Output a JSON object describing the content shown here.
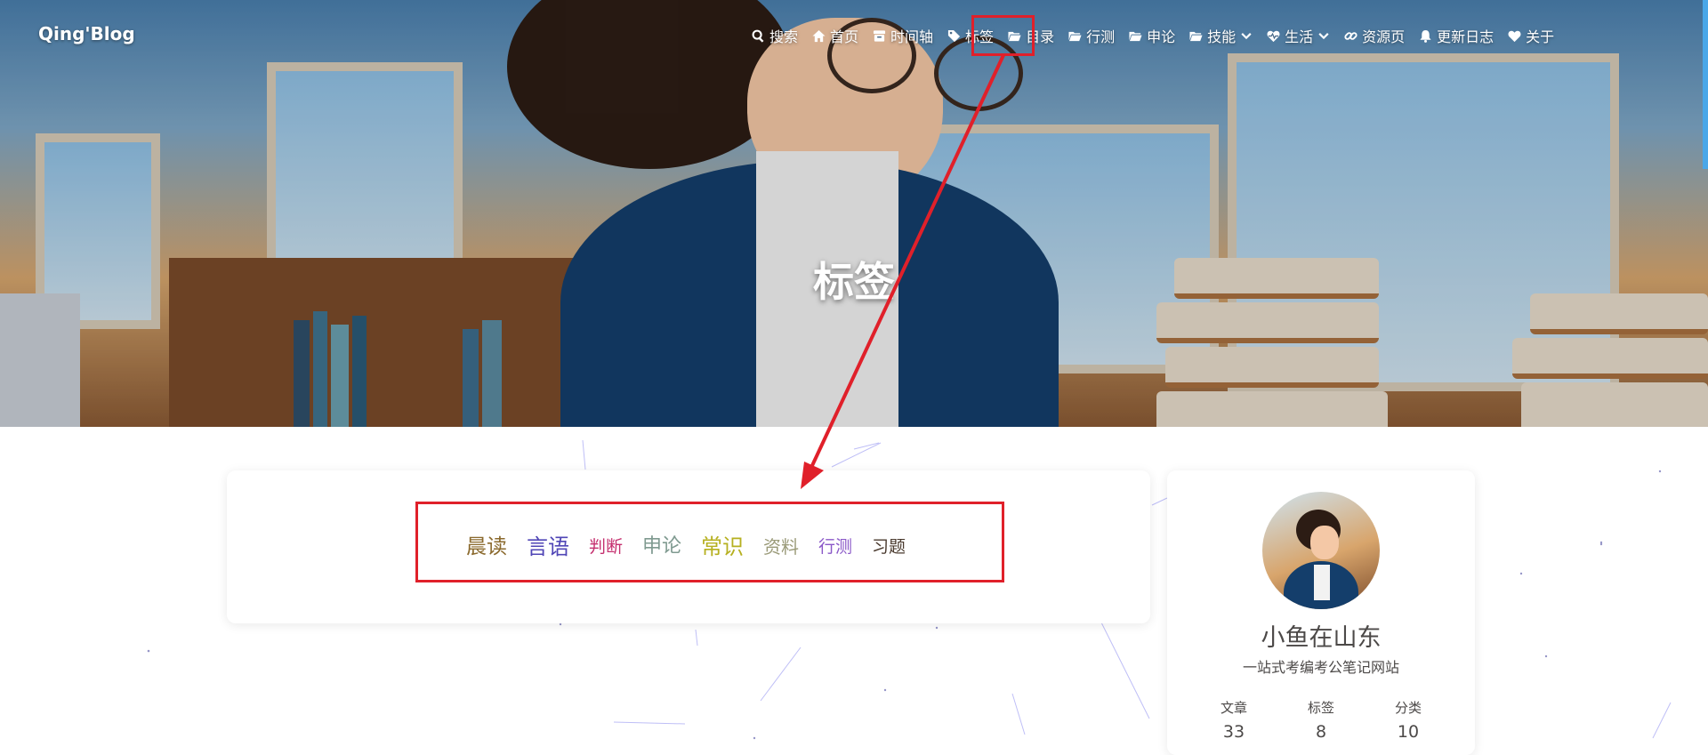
{
  "site": {
    "brand": "Qing'Blog"
  },
  "nav": {
    "items": [
      {
        "label": "搜索",
        "icon": "search-icon"
      },
      {
        "label": "首页",
        "icon": "home-icon"
      },
      {
        "label": "时间轴",
        "icon": "archive-icon"
      },
      {
        "label": "标签",
        "icon": "tag-icon"
      },
      {
        "label": "目录",
        "icon": "folder-icon"
      },
      {
        "label": "行测",
        "icon": "folder-icon"
      },
      {
        "label": "申论",
        "icon": "folder-icon"
      },
      {
        "label": "技能",
        "icon": "folder-icon",
        "dropdown": true
      },
      {
        "label": "生活",
        "icon": "heartbeat-icon",
        "dropdown": true
      },
      {
        "label": "资源页",
        "icon": "link-icon"
      },
      {
        "label": "更新日志",
        "icon": "bell-icon"
      },
      {
        "label": "关于",
        "icon": "heart-icon"
      }
    ]
  },
  "page": {
    "title": "标签"
  },
  "tags": [
    {
      "label": "晨读",
      "color": "#8b6a2e"
    },
    {
      "label": "言语",
      "color": "#5046b6"
    },
    {
      "label": "判断",
      "color": "#c5306f"
    },
    {
      "label": "申论",
      "color": "#7f9a90"
    },
    {
      "label": "常识",
      "color": "#b6b020"
    },
    {
      "label": "资料",
      "color": "#9a9a78"
    },
    {
      "label": "行测",
      "color": "#8a58c8"
    },
    {
      "label": "习题",
      "color": "#4a3a2e"
    }
  ],
  "profile": {
    "name": "小鱼在山东",
    "description": "一站式考编考公笔记网站",
    "stats": [
      {
        "label": "文章",
        "value": "33"
      },
      {
        "label": "标签",
        "value": "8"
      },
      {
        "label": "分类",
        "value": "10"
      }
    ]
  },
  "colors": {
    "annotation": "#e0202a",
    "text": "#4c4948"
  }
}
